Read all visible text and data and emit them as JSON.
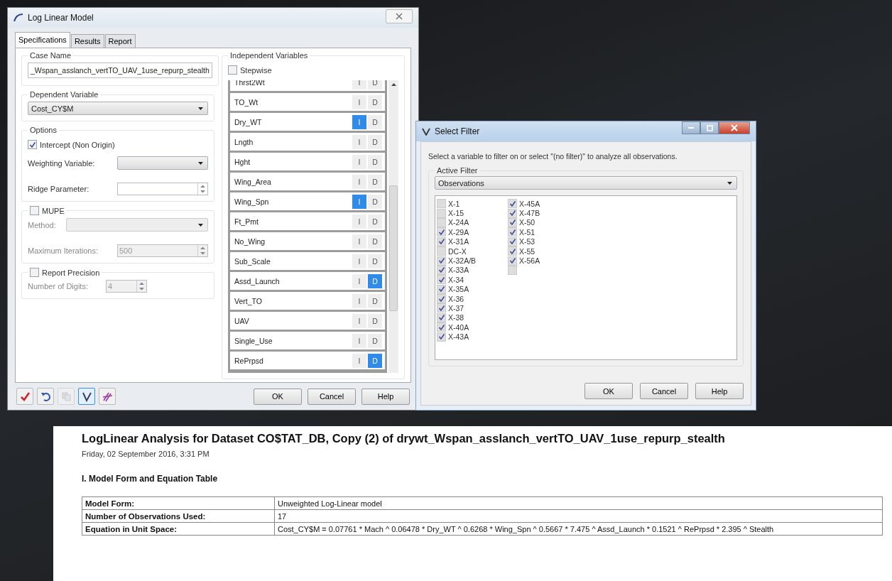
{
  "main_dialog": {
    "title": "Log Linear Model",
    "tabs": [
      {
        "label": "Specifications",
        "selected": true
      },
      {
        "label": "Results",
        "selected": false
      },
      {
        "label": "Report",
        "selected": false
      }
    ],
    "case_name": {
      "label": "Case Name",
      "value": "_Wspan_asslanch_vertTO_UAV_1use_repurp_stealth"
    },
    "dependent_variable": {
      "label": "Dependent Variable",
      "value": "Cost_CY$M"
    },
    "options": {
      "label": "Options",
      "intercept": {
        "label": "Intercept (Non Origin)",
        "checked": true
      },
      "weighting_label": "Weighting Variable:",
      "ridge_label": "Ridge Parameter:"
    },
    "mupe": {
      "label": "MUPE",
      "checked": false,
      "method_label": "Method:",
      "iterations_label": "Maximum Iterations:",
      "iterations": "500"
    },
    "precision": {
      "label": "Report Precision",
      "checked": false,
      "digits_label": "Number of Digits:",
      "digits": "4"
    },
    "independent": {
      "label": "Independent Variables",
      "stepwise": {
        "label": "Stepwise",
        "checked": false
      },
      "variables": [
        {
          "name": "Thrst2Wt",
          "toggles": [
            {
              "label": "I",
              "selected": false
            },
            {
              "label": "D",
              "selected": false
            }
          ]
        },
        {
          "name": "TO_Wt",
          "toggles": [
            {
              "label": "I",
              "selected": false
            },
            {
              "label": "D",
              "selected": false
            }
          ]
        },
        {
          "name": "Dry_WT",
          "toggles": [
            {
              "label": "I",
              "selected": true
            },
            {
              "label": "D",
              "selected": false
            }
          ]
        },
        {
          "name": "Lngth",
          "toggles": [
            {
              "label": "I",
              "selected": false
            },
            {
              "label": "D",
              "selected": false
            }
          ]
        },
        {
          "name": "Hght",
          "toggles": [
            {
              "label": "I",
              "selected": false
            },
            {
              "label": "D",
              "selected": false
            }
          ]
        },
        {
          "name": "Wing_Area",
          "toggles": [
            {
              "label": "I",
              "selected": false
            },
            {
              "label": "D",
              "selected": false
            }
          ]
        },
        {
          "name": "Wing_Spn",
          "toggles": [
            {
              "label": "I",
              "selected": true
            },
            {
              "label": "D",
              "selected": false
            }
          ]
        },
        {
          "name": "Ft_Pmt",
          "toggles": [
            {
              "label": "I",
              "selected": false
            },
            {
              "label": "D",
              "selected": false
            }
          ]
        },
        {
          "name": "No_Wing",
          "toggles": [
            {
              "label": "I",
              "selected": false
            },
            {
              "label": "D",
              "selected": false
            }
          ]
        },
        {
          "name": "Sub_Scale",
          "toggles": [
            {
              "label": "I",
              "selected": false
            },
            {
              "label": "D",
              "selected": false
            }
          ]
        },
        {
          "name": "Assd_Launch",
          "toggles": [
            {
              "label": "I",
              "selected": false
            },
            {
              "label": "D",
              "selected": true
            }
          ]
        },
        {
          "name": "Vert_TO",
          "toggles": [
            {
              "label": "I",
              "selected": false
            },
            {
              "label": "D",
              "selected": false
            }
          ]
        },
        {
          "name": "UAV",
          "toggles": [
            {
              "label": "I",
              "selected": false
            },
            {
              "label": "D",
              "selected": false
            }
          ]
        },
        {
          "name": "Single_Use",
          "toggles": [
            {
              "label": "I",
              "selected": false
            },
            {
              "label": "D",
              "selected": false
            }
          ]
        },
        {
          "name": "RePrpsd",
          "toggles": [
            {
              "label": "I",
              "selected": false
            },
            {
              "label": "D",
              "selected": true
            }
          ]
        }
      ]
    },
    "toolbar": [
      {
        "kind": "accept",
        "selected": false,
        "disabled": false
      },
      {
        "kind": "undo",
        "selected": false,
        "disabled": false
      },
      {
        "kind": "copy",
        "selected": false,
        "disabled": true
      },
      {
        "kind": "filter",
        "selected": true,
        "disabled": false
      },
      {
        "kind": "hatch",
        "selected": false,
        "disabled": false
      }
    ],
    "buttons": [
      "OK",
      "Cancel",
      "Help"
    ]
  },
  "filter_dialog": {
    "title": "Select Filter",
    "instruction": "Select a variable to filter on or select \"(no filter)\" to analyze all observations.",
    "group_label": "Active Filter",
    "filter": "Observations",
    "observations": [
      {
        "label": "X-1",
        "checked": false
      },
      {
        "label": "X-15",
        "checked": false
      },
      {
        "label": "X-24A",
        "checked": false
      },
      {
        "label": "X-29A",
        "checked": true
      },
      {
        "label": "X-31A",
        "checked": true
      },
      {
        "label": "DC-X",
        "checked": false
      },
      {
        "label": "X-32A/B",
        "checked": true
      },
      {
        "label": "X-33A",
        "checked": true
      },
      {
        "label": "X-34",
        "checked": true
      },
      {
        "label": "X-35A",
        "checked": true
      },
      {
        "label": "X-36",
        "checked": true
      },
      {
        "label": "X-37",
        "checked": true
      },
      {
        "label": "X-38",
        "checked": true
      },
      {
        "label": "X-40A",
        "checked": true
      },
      {
        "label": "X-43A",
        "checked": true
      },
      {
        "label": "X-45A",
        "checked": true
      },
      {
        "label": "X-47B",
        "checked": true
      },
      {
        "label": "X-50",
        "checked": true
      },
      {
        "label": "X-51",
        "checked": true
      },
      {
        "label": "X-53",
        "checked": true
      },
      {
        "label": "X-55",
        "checked": true
      },
      {
        "label": "X-56A",
        "checked": true
      },
      {
        "checked": false
      }
    ],
    "buttons": [
      "OK",
      "Cancel",
      "Help"
    ]
  },
  "report": {
    "title": "LogLinear Analysis for Dataset CO$TAT_DB, Copy (2) of drywt_Wspan_asslanch_vertTO_UAV_1use_repurp_stealth",
    "date": "Friday, 02 September 2016, 3:31 PM",
    "section": "I. Model Form and Equation Table",
    "rows": [
      {
        "label": "Model Form:",
        "value": "Unweighted Log-Linear model"
      },
      {
        "label": "Number of Observations Used:",
        "value": "17"
      },
      {
        "label": "Equation in Unit Space:",
        "value": "Cost_CY$M = 0.07761 * Mach ^ 0.06478 * Dry_WT ^ 0.6268 * Wing_Spn ^ 0.5667 * 7.475 ^ Assd_Launch * 0.1521 ^ RePrpsd * 2.395 ^ Stealth"
      }
    ]
  }
}
